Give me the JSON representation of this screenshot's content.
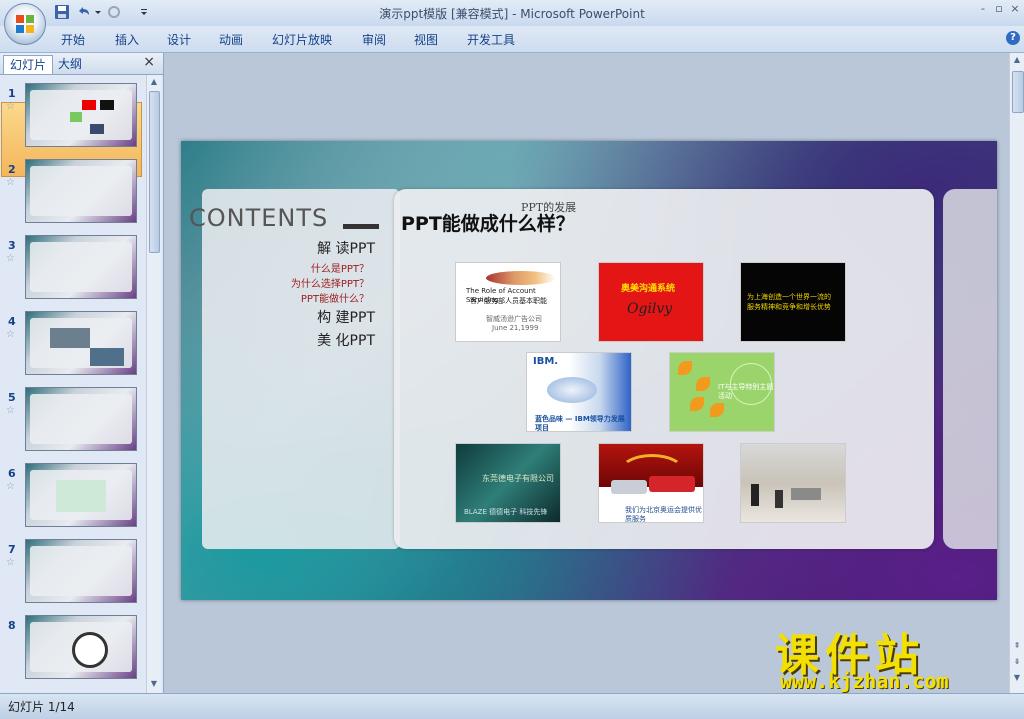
{
  "window": {
    "title": "演示ppt模版 [兼容模式] - Microsoft PowerPoint",
    "controls": [
      "-",
      "▫",
      "×"
    ]
  },
  "ribbon": {
    "tabs": [
      "开始",
      "插入",
      "设计",
      "动画",
      "幻灯片放映",
      "审阅",
      "视图",
      "开发工具"
    ],
    "help": "?"
  },
  "left_panel": {
    "tabs": [
      "幻灯片",
      "大纲"
    ],
    "close": "×",
    "thumbnails": [
      {
        "number": "1",
        "selected": true
      },
      {
        "number": "2",
        "selected": false
      },
      {
        "number": "3",
        "selected": false
      },
      {
        "number": "4",
        "selected": false
      },
      {
        "number": "5",
        "selected": false
      },
      {
        "number": "6",
        "selected": false
      },
      {
        "number": "7",
        "selected": false
      },
      {
        "number": "8",
        "selected": false
      }
    ]
  },
  "slide": {
    "contents_label": "CONTENTS",
    "menu": {
      "item1": "解 读PPT",
      "sub1": "什么是PPT？",
      "sub2": "为什么选择PPT？",
      "sub3": "PPT能做什么？",
      "item2": "构 建PPT",
      "item3": "美 化PPT"
    },
    "subtitle": "PPT的发展",
    "title": "PPT能做成什么样？",
    "pictures": {
      "p1": {
        "line1": "The Role of Account Servicing",
        "line2": "客户服务部人员基本职能",
        "line3": "智威汤逊广告公司",
        "line4": "June 21,1999"
      },
      "p2": {
        "line1": "奥美沟通系统",
        "line2": "Ogilvy"
      },
      "p3": {
        "line1": "为上海创造一个世界一流的",
        "line2": "服务精神和竞争和增长优势"
      },
      "p4": {
        "brand": "IBM.",
        "line1": "蓝色品味 — IBM领导力发展项目"
      },
      "p5": {
        "line1": "IT与主导特别主题活动"
      },
      "p6": {
        "line1": "东莞德电子有限公司",
        "line2": "BLAZE 德德电子 科技先锋"
      },
      "p7": {
        "line1": "我们为北京奥运会提供优质服务"
      },
      "p8": {
        "line1": ""
      }
    }
  },
  "status": {
    "slide_position": "幻灯片 1/14"
  },
  "watermark": {
    "cn": "课件站",
    "url": "www.kjzhan.com"
  }
}
